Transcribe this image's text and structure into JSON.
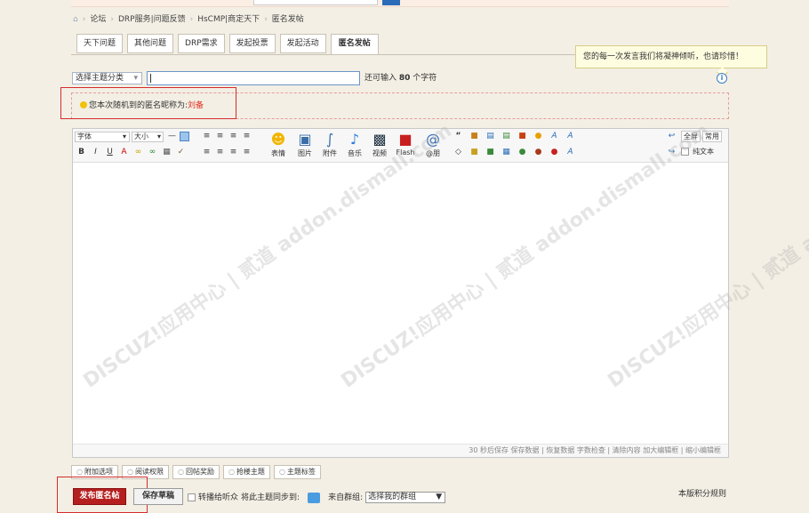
{
  "breadcrumb": {
    "items": [
      "论坛",
      "DRP服务|问题反馈",
      "HsCMP|商定天下",
      "匿名发帖"
    ]
  },
  "tabs": [
    {
      "label": "天下问题"
    },
    {
      "label": "其他问题"
    },
    {
      "label": "DRP需求"
    },
    {
      "label": "发起投票"
    },
    {
      "label": "发起活动"
    },
    {
      "label": "匿名发帖",
      "active": true
    }
  ],
  "tip": {
    "text": "您的每一次发言我们将凝神倾听，也请珍惜！"
  },
  "form": {
    "category_select": "选择主题分类",
    "title_value": "",
    "char_prefix": "还可输入",
    "char_count": "80",
    "char_suffix": "个字符"
  },
  "anonymous": {
    "prefix": "您本次随机到的匿名昵称为:",
    "nickname": "刘备"
  },
  "editor": {
    "font_select": "字体",
    "size_select": "大小",
    "big_buttons": [
      "表情",
      "图片",
      "附件",
      "音乐",
      "视频",
      "Flash",
      "@朋"
    ],
    "right_buttons": [
      "全屏",
      "常用",
      "纯文本"
    ],
    "watermark": "DISCUZ!应用中心 | 贰道 addon.dismall.com",
    "status": "30 秒后保存 保存数据 | 恢复数据   字数检查 | 清除内容   加大编辑框 | 缩小编辑框"
  },
  "options": {
    "tabs": [
      "附加选项",
      "阅读权限",
      "回帖奖励",
      "抢楼主题",
      "主题标签"
    ]
  },
  "actions": {
    "submit": "发布匿名帖",
    "draft": "保存草稿",
    "broadcast": "转播给听众",
    "sync_label": "将此主题同步到:",
    "group_label": "来自群组:",
    "group_select": "选择我的群组",
    "rules": "本版积分规则"
  }
}
